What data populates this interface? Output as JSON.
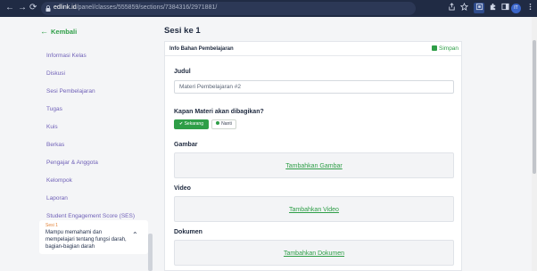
{
  "browser": {
    "url_host": "edlink.id",
    "url_path": "/panel/classes/555859/sections/7384316/2971881/",
    "back_glyph": "←",
    "forward_glyph": "→",
    "reload_glyph": "⟳",
    "profile_initials": "IT"
  },
  "sidebar": {
    "back_label": "Kembali",
    "items": [
      {
        "label": "Informasi Kelas"
      },
      {
        "label": "Diskusi"
      },
      {
        "label": "Sesi Pembelajaran"
      },
      {
        "label": "Tugas"
      },
      {
        "label": "Kuis"
      },
      {
        "label": "Berkas"
      },
      {
        "label": "Pengajar & Anggota"
      },
      {
        "label": "Kelompok"
      },
      {
        "label": "Laporan"
      },
      {
        "label": "Student Engagement Score (SES)"
      }
    ],
    "session_card": {
      "small": "Sesi 1",
      "desc": "Mampu memahami dan mempelajari tentang fungsi darah, bagian-bagian darah",
      "chevron": "⌃"
    }
  },
  "main": {
    "page_title": "Sesi ke 1",
    "panel_title": "Info Bahan Pembelajaran",
    "save_label": "Simpan",
    "judul_label": "Judul",
    "judul_value": "Materi Pembelajaran #2",
    "share_question": "Kapan Materi akan dibagikan?",
    "share_now": "Sekarang",
    "share_later": "Nanti",
    "gambar_label": "Gambar",
    "gambar_link": "Tambahkan Gambar",
    "video_label": "Video",
    "video_link": "Tambahkan Video",
    "dokumen_label": "Dokumen",
    "dokumen_link": "Tambahkan Dokumen"
  },
  "colors": {
    "accent_green": "#2e9e47",
    "menu_purple": "#7061b8",
    "chrome_bg": "#202b44"
  }
}
